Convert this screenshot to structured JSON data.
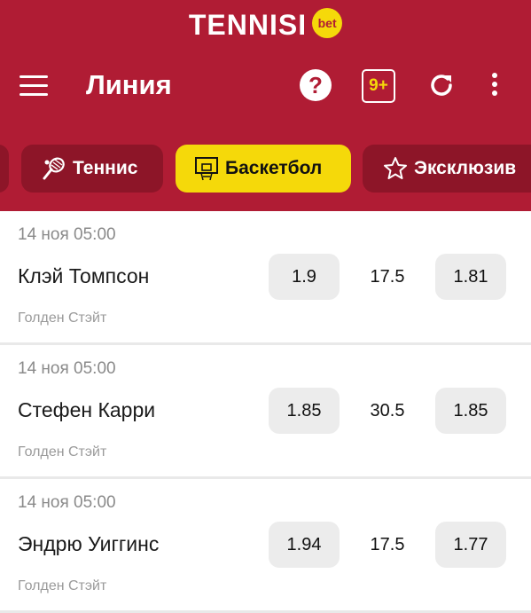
{
  "brand": {
    "name": "TENNISI",
    "badge": "bet"
  },
  "toolbar": {
    "title": "Линия",
    "help_glyph": "?",
    "age_label": "9+"
  },
  "colors": {
    "header": "#b01c34",
    "chip": "#8d1528",
    "accent": "#f5d90a",
    "odds_bg": "#ececec"
  },
  "sport_tabs": [
    {
      "label": "",
      "icon": "sport-icon"
    },
    {
      "label": "Теннис",
      "icon": "tennis-icon"
    },
    {
      "label": "Баскетбол",
      "icon": "basketball-icon",
      "active": true
    },
    {
      "label": "Эксклюзив",
      "icon": "star-icon"
    }
  ],
  "events": [
    {
      "time": "14 ноя 05:00",
      "player": "Клэй Томпсон",
      "team": "Голден Стэйт",
      "odd_under": "1.9",
      "total": "17.5",
      "odd_over": "1.81"
    },
    {
      "time": "14 ноя 05:00",
      "player": "Стефен Карри",
      "team": "Голден Стэйт",
      "odd_under": "1.85",
      "total": "30.5",
      "odd_over": "1.85"
    },
    {
      "time": "14 ноя 05:00",
      "player": "Эндрю Уиггинс",
      "team": "Голден Стэйт",
      "odd_under": "1.94",
      "total": "17.5",
      "odd_over": "1.77"
    }
  ]
}
